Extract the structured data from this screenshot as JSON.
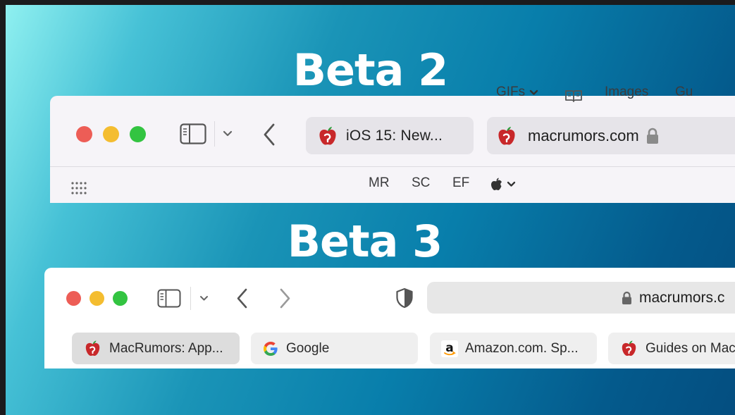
{
  "headings": {
    "beta2": "Beta 2",
    "beta3": "Beta 3"
  },
  "beta2": {
    "tab_title": "iOS 15: New...",
    "address": "macrumors.com",
    "bookmarks": [
      "MR",
      "SC",
      "EF",
      "GIFs",
      "Images",
      "Gu"
    ]
  },
  "beta3": {
    "address": "macrumors.c",
    "tabs": [
      {
        "title": "MacRumors: App...",
        "icon": "macrumors-apple-icon",
        "active": true
      },
      {
        "title": "Google",
        "icon": "google-g-icon",
        "active": false
      },
      {
        "title": "Amazon.com. Sp...",
        "icon": "amazon-a-icon",
        "active": false
      },
      {
        "title": "Guides on Mac",
        "icon": "macrumors-apple-icon",
        "active": false
      }
    ]
  },
  "colors": {
    "close": "#ed5d56",
    "minimize": "#f4bd30",
    "zoom": "#33c441",
    "brand_red": "#c8282a",
    "icon_gray": "#555555"
  }
}
